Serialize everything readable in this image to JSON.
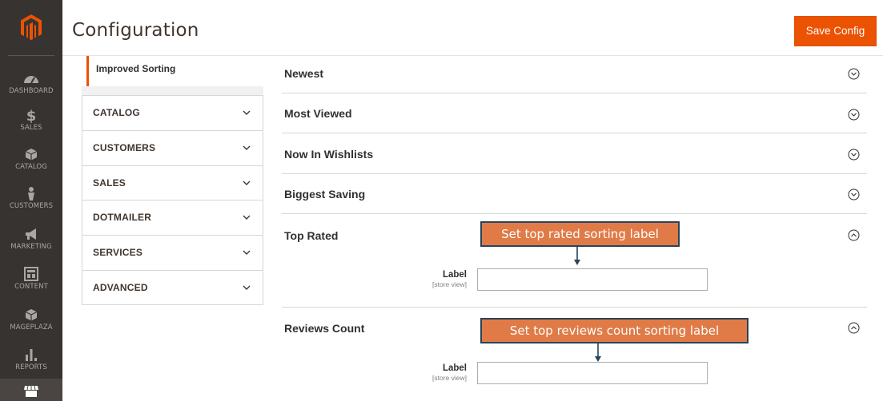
{
  "header": {
    "title": "Configuration",
    "save_label": "Save Config"
  },
  "sidebar": {
    "items": [
      {
        "label": "DASHBOARD",
        "icon": "dashboard-icon"
      },
      {
        "label": "SALES",
        "icon": "dollar-icon"
      },
      {
        "label": "CATALOG",
        "icon": "box-icon"
      },
      {
        "label": "CUSTOMERS",
        "icon": "person-icon"
      },
      {
        "label": "MARKETING",
        "icon": "megaphone-icon"
      },
      {
        "label": "CONTENT",
        "icon": "layout-icon"
      },
      {
        "label": "MAGEPLAZA",
        "icon": "box-icon"
      },
      {
        "label": "REPORTS",
        "icon": "bar-chart-icon"
      },
      {
        "label": "",
        "icon": "store-icon"
      }
    ]
  },
  "config_nav": {
    "active_item": "Improved Sorting",
    "tabs": [
      {
        "label": "CATALOG"
      },
      {
        "label": "CUSTOMERS"
      },
      {
        "label": "SALES"
      },
      {
        "label": "DOTMAILER"
      },
      {
        "label": "SERVICES"
      },
      {
        "label": "ADVANCED"
      }
    ]
  },
  "sections": [
    {
      "title": "Newest",
      "state": "collapsed"
    },
    {
      "title": "Most Viewed",
      "state": "collapsed"
    },
    {
      "title": "Now In Wishlists",
      "state": "collapsed"
    },
    {
      "title": "Biggest Saving",
      "state": "collapsed"
    },
    {
      "title": "Top Rated",
      "state": "expanded",
      "field": {
        "label": "Label",
        "scope": "[store view]",
        "value": ""
      },
      "callout": "Set top rated sorting label"
    },
    {
      "title": "Reviews Count",
      "state": "expanded",
      "field": {
        "label": "Label",
        "scope": "[store view]",
        "value": ""
      },
      "callout": "Set top reviews count sorting label"
    }
  ],
  "colors": {
    "accent": "#eb5202",
    "sidebar_bg": "#373330",
    "callout_bg": "#e07b47",
    "callout_border": "#27445a"
  }
}
